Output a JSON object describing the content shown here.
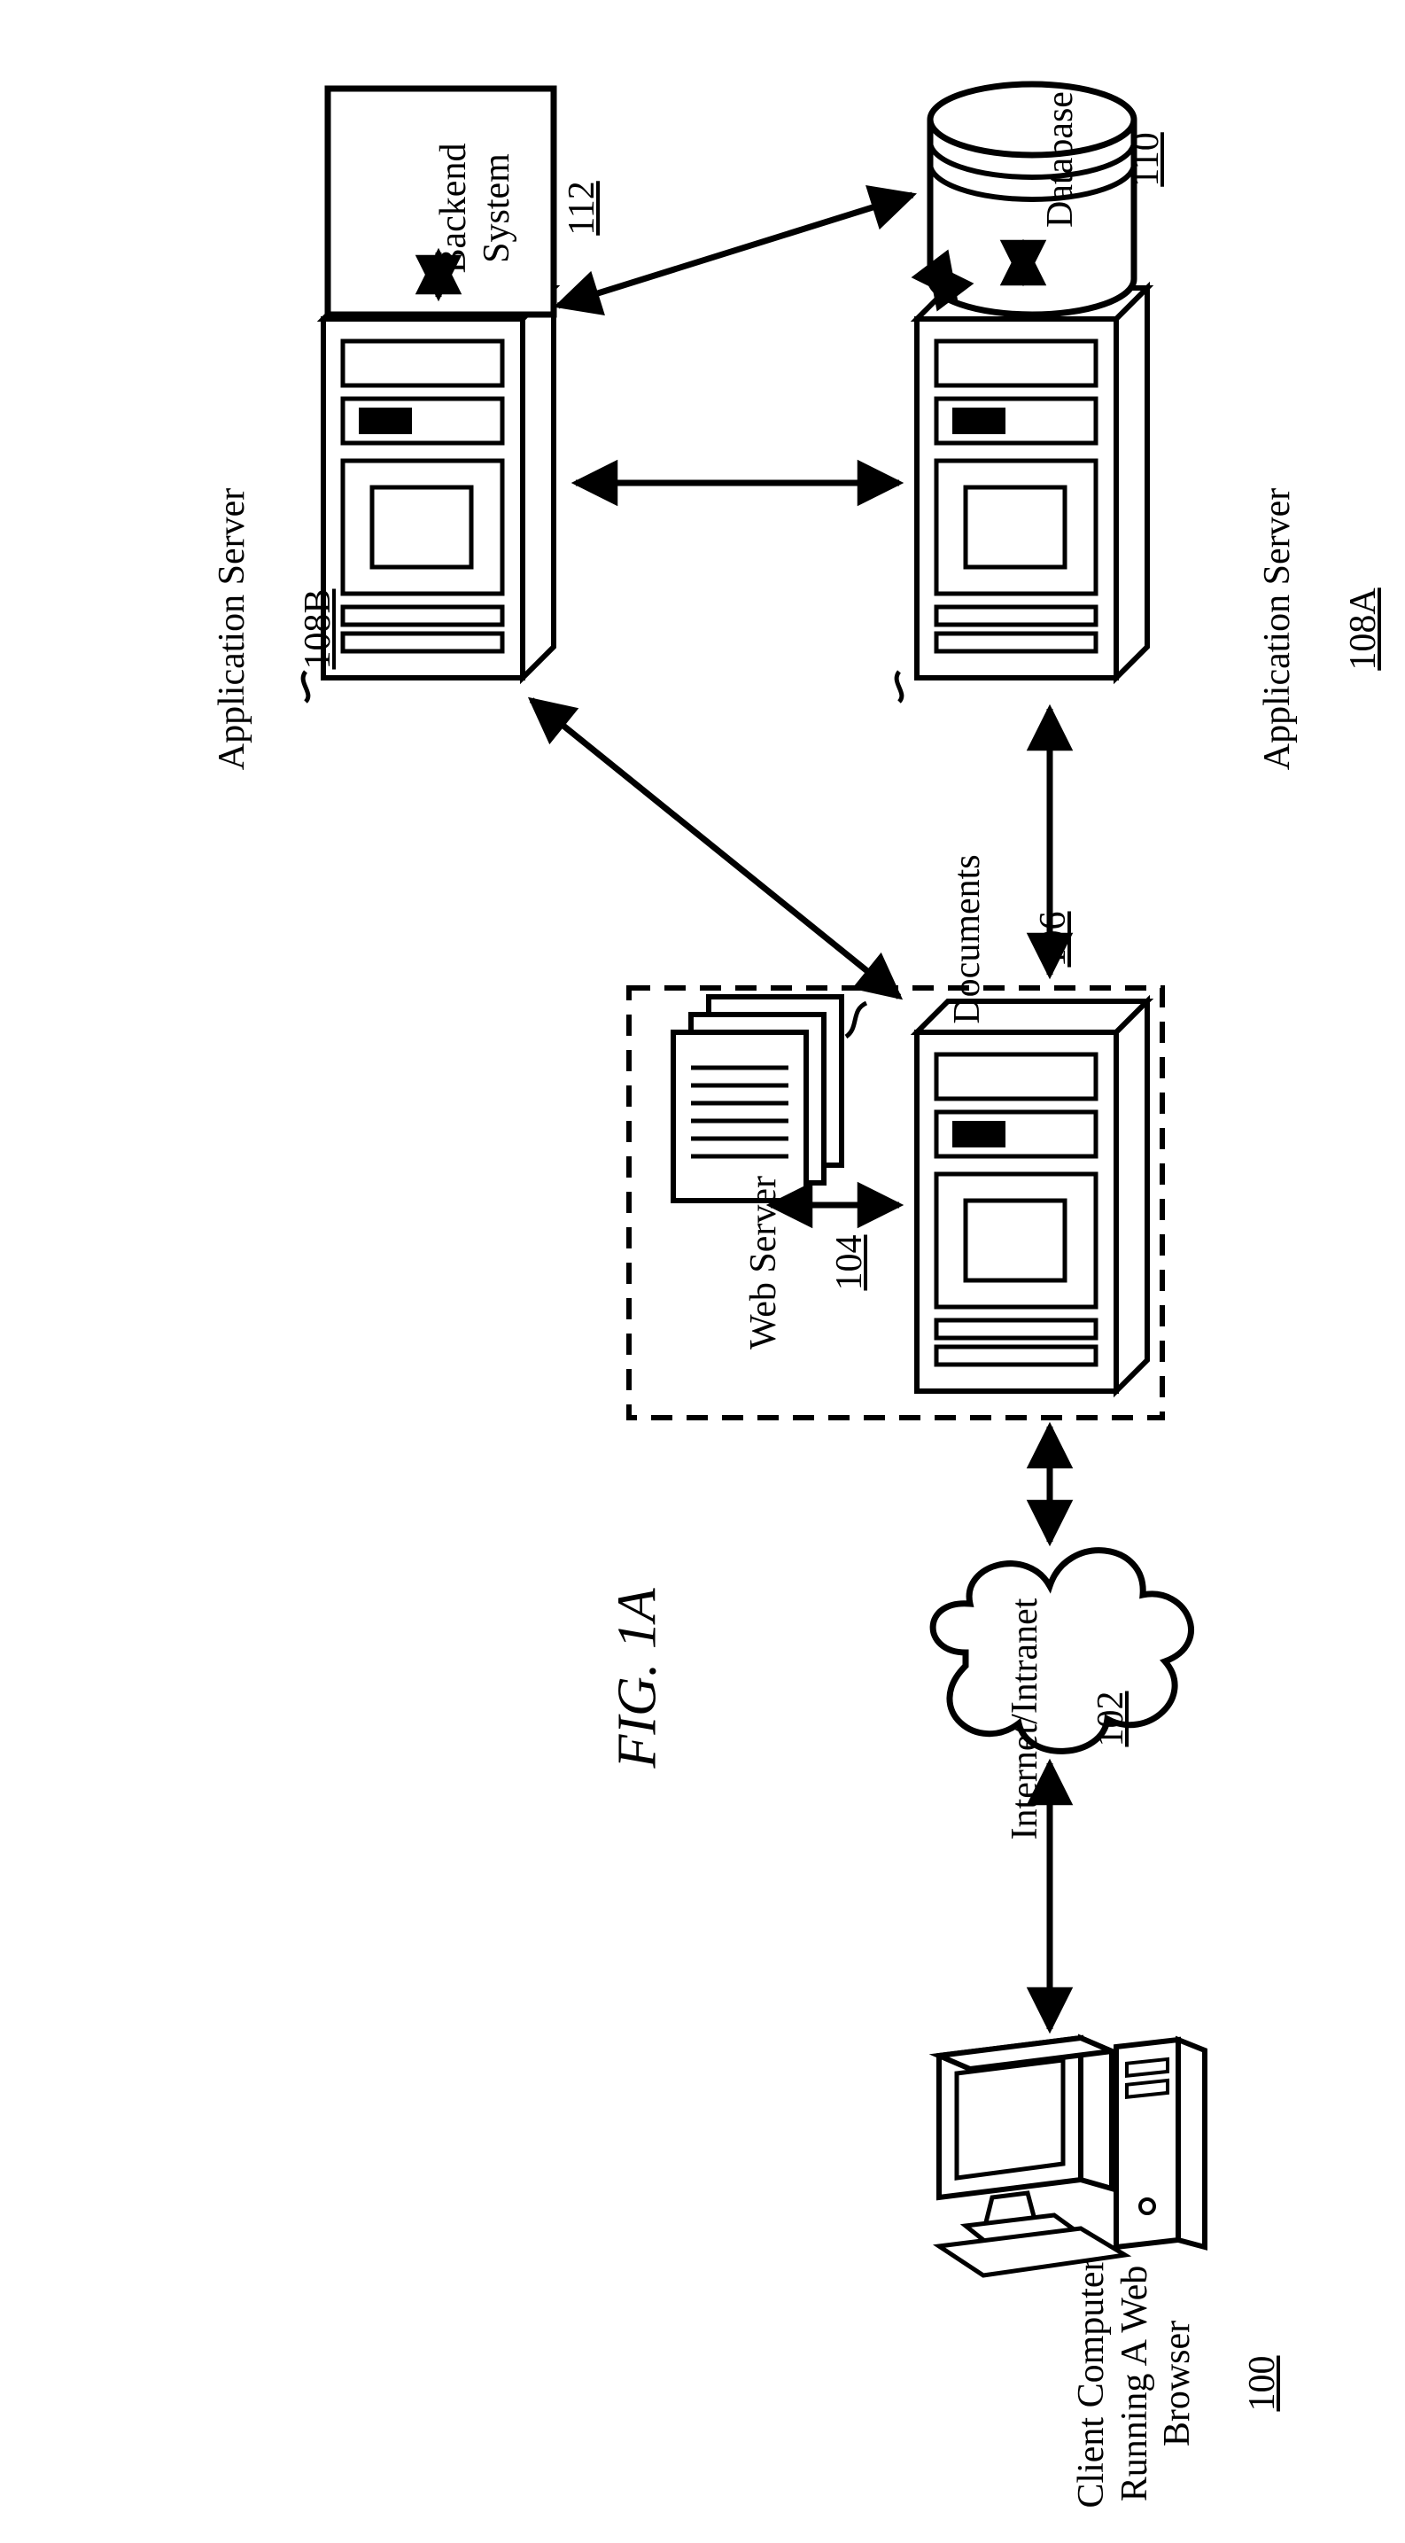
{
  "figure_label": "FIG. 1A",
  "nodes": {
    "client": {
      "label": "Client Computer\nRunning A Web\nBrowser",
      "ref": "100"
    },
    "cloud": {
      "label": "Internet/Intranet",
      "ref": "102"
    },
    "webserver": {
      "label": "Web Server",
      "ref": "104"
    },
    "documents": {
      "label": "Documents",
      "ref": "106"
    },
    "appserver_a": {
      "label": "Application Server",
      "ref": "108A"
    },
    "appserver_b": {
      "label": "Application Server",
      "ref": "108B"
    },
    "database": {
      "label": "Database",
      "ref": "110"
    },
    "backend": {
      "label": "Backend\nSystem",
      "ref": "112"
    }
  }
}
